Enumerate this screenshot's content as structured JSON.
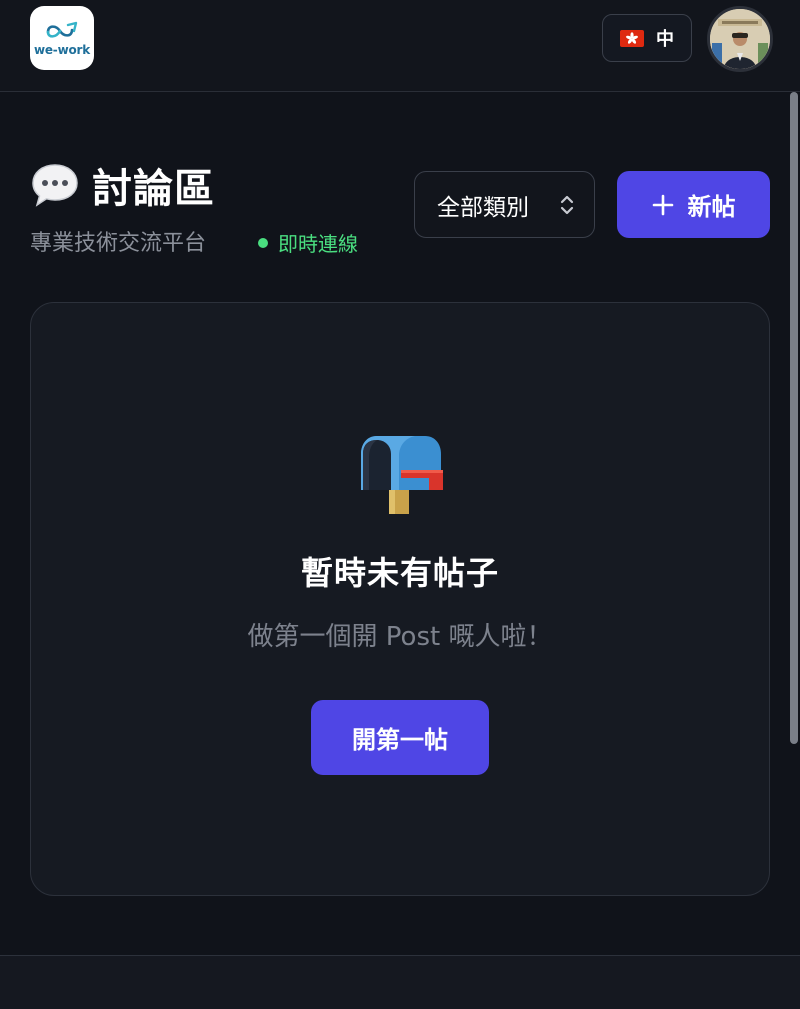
{
  "header": {
    "logo_text": "we-work",
    "language": {
      "label": "中",
      "flag": "hk-flag-icon"
    },
    "avatar": "user-avatar"
  },
  "forum": {
    "title_icon": "speech-bubble-icon",
    "title": "討論區",
    "subtitle": "專業技術交流平台",
    "status_text": "即時連線",
    "status_color": "#4ade80",
    "category_select": {
      "selected": "全部類別"
    },
    "new_post_label": "新帖"
  },
  "empty_state": {
    "icon": "mailbox-icon",
    "title": "暫時未有帖子",
    "message": "做第一個開 Post 嘅人啦！",
    "button_label": "開第一帖"
  },
  "colors": {
    "background": "#10131a",
    "accent": "#4f46e5",
    "card": "#161a22"
  }
}
